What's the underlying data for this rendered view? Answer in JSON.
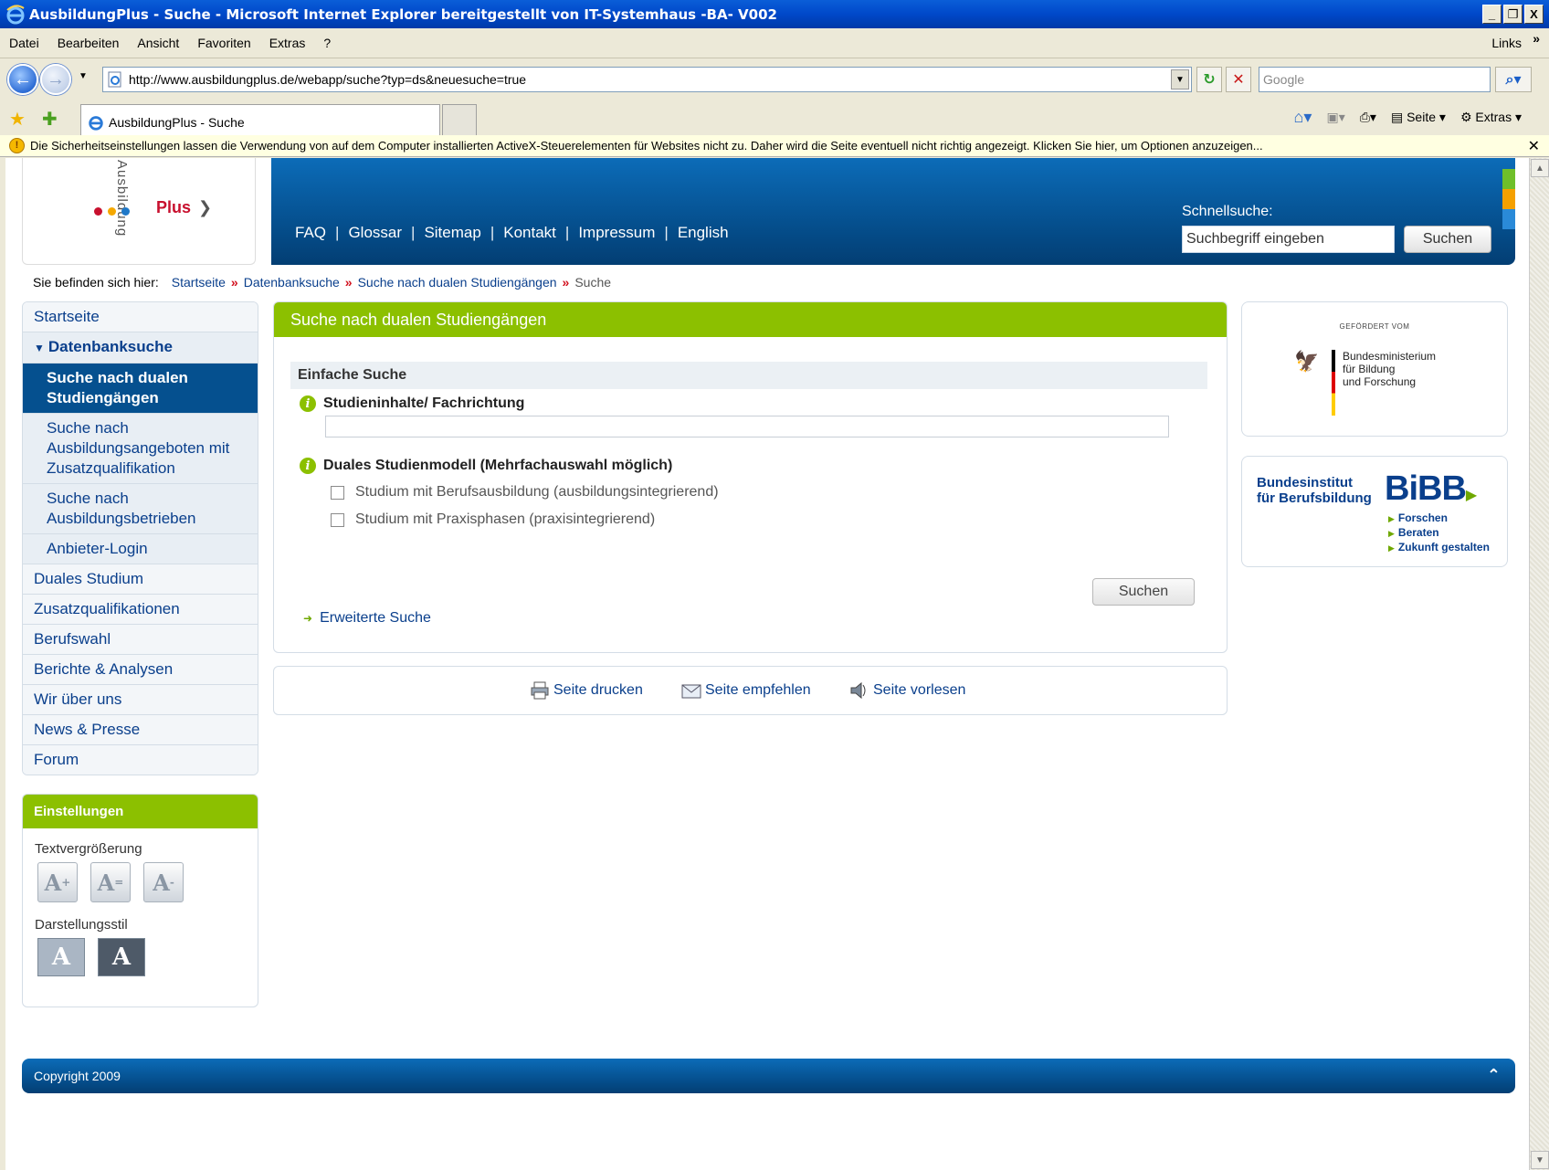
{
  "window": {
    "title": "AusbildungPlus - Suche - Microsoft Internet Explorer bereitgestellt von IT-Systemhaus -BA- V002",
    "buttons": {
      "minimize": "_",
      "maximize": " ",
      "close": "X"
    }
  },
  "menu": {
    "items": [
      "Datei",
      "Bearbeiten",
      "Ansicht",
      "Favoriten",
      "Extras",
      "?"
    ],
    "links": "Links",
    "more": "»"
  },
  "address": {
    "url": "http://www.ausbildungplus.de/webapp/suche?typ=ds&neuesuche=true",
    "search_placeholder": "Google"
  },
  "tabs": {
    "active_label": "AusbildungPlus - Suche",
    "tools": {
      "page": "Seite",
      "extras": "Extras"
    }
  },
  "infobar": {
    "text": "Die Sicherheitseinstellungen lassen die Verwendung von auf dem Computer installierten ActiveX-Steuerelementen für Websites nicht zu. Daher wird die Seite eventuell nicht richtig angezeigt. Klicken Sie hier, um Optionen anzuzeigen...",
    "close": "✕"
  },
  "logo": {
    "arc_text": "Ausbildung",
    "plus": "Plus",
    "arrow": "❯",
    "dot_colors": [
      "#c8102e",
      "#f5a800",
      "#1f78c8"
    ]
  },
  "header": {
    "nav": [
      "FAQ",
      "Glossar",
      "Sitemap",
      "Kontakt",
      "Impressum",
      "English"
    ],
    "quick_search_label": "Schnellsuche:",
    "quick_search_placeholder": "Suchbegriff eingeben",
    "quick_search_button": "Suchen",
    "strip_colors": [
      "#6fbf2a",
      "#f5a000",
      "#2a8ad8"
    ]
  },
  "breadcrumb": {
    "prefix": "Sie befinden sich hier:",
    "items": [
      "Startseite",
      "Datenbanksuche",
      "Suche nach dualen Studiengängen"
    ],
    "current": "Suche",
    "separator": "»"
  },
  "sidebar": {
    "items": [
      {
        "label": "Startseite"
      },
      {
        "label": "Datenbanksuche"
      },
      {
        "label": "Suche nach dualen Studiengängen"
      },
      {
        "label": "Suche nach Ausbildungsangeboten mit Zusatzqualifikation"
      },
      {
        "label": "Suche nach Ausbildungsbetrieben"
      },
      {
        "label": "Anbieter-Login"
      },
      {
        "label": "Duales Studium"
      },
      {
        "label": "Zusatzqualifikationen"
      },
      {
        "label": "Berufswahl"
      },
      {
        "label": "Berichte & Analysen"
      },
      {
        "label": "Wir über uns"
      },
      {
        "label": "News & Presse"
      },
      {
        "label": "Forum"
      }
    ]
  },
  "settings": {
    "title": "Einstellungen",
    "text_size_label": "Textvergrößerung",
    "text_size_buttons": [
      "A",
      "A",
      "A"
    ],
    "text_size_marks": [
      "+",
      "=",
      "-"
    ],
    "style_label": "Darstellungsstil",
    "style_buttons": [
      "A",
      "A"
    ],
    "style_colors": [
      "#aab6c4",
      "#4e5a68"
    ]
  },
  "main": {
    "title": "Suche nach dualen Studiengängen",
    "section": "Einfache Suche",
    "field1_label": "Studieninhalte/ Fachrichtung",
    "field1_value": "",
    "field2_label": "Duales Studienmodell (Mehrfachauswahl möglich)",
    "options": [
      {
        "label": "Studium mit Berufsausbildung (ausbildungsintegrierend)",
        "checked": false
      },
      {
        "label": "Studium mit Praxisphasen (praxisintegrierend)",
        "checked": false
      }
    ],
    "search_button": "Suchen",
    "advanced_link": "Erweiterte Suche"
  },
  "page_tools": [
    "Seite drucken",
    "Seite empfehlen",
    "Seite vorlesen"
  ],
  "bmbf": {
    "funded_by": "GEFÖRDERT VOM",
    "lines": [
      "Bundesministerium",
      "für Bildung",
      "und Forschung"
    ]
  },
  "bibb": {
    "institute_line1": "Bundesinstitut",
    "institute_line2": "für Berufsbildung",
    "logo": "BiBB",
    "tags": [
      "Forschen",
      "Beraten",
      "Zukunft gestalten"
    ]
  },
  "footer": {
    "copyright": "Copyright 2009"
  }
}
